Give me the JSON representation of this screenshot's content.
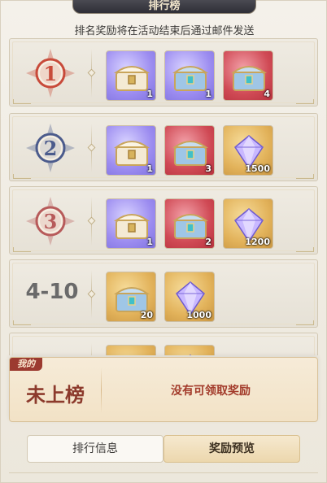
{
  "header": {
    "title": "排行榜",
    "subtitle": "排名奖励将在活动结束后通过邮件发送"
  },
  "rows": [
    {
      "rank_label": "1",
      "badge_color": "#c84a3a",
      "items": [
        {
          "kind": "purple",
          "icon": "chest-icon",
          "qty": "1"
        },
        {
          "kind": "purple",
          "icon": "chest-blue-icon",
          "qty": "1"
        },
        {
          "kind": "red",
          "icon": "chest-blue-icon",
          "qty": "4"
        }
      ]
    },
    {
      "rank_label": "2",
      "badge_color": "#4b5b8c",
      "items": [
        {
          "kind": "purple",
          "icon": "chest-icon",
          "qty": "1"
        },
        {
          "kind": "red",
          "icon": "chest-blue-icon",
          "qty": "3"
        },
        {
          "kind": "gold",
          "icon": "crystal-icon",
          "qty": "1500"
        }
      ]
    },
    {
      "rank_label": "3",
      "badge_color": "#b75a5a",
      "items": [
        {
          "kind": "purple",
          "icon": "chest-icon",
          "qty": "1"
        },
        {
          "kind": "red",
          "icon": "chest-blue-icon",
          "qty": "2"
        },
        {
          "kind": "gold",
          "icon": "crystal-icon",
          "qty": "1200"
        }
      ]
    },
    {
      "rank_label": "4-10",
      "badge_color": "",
      "items": [
        {
          "kind": "gold",
          "icon": "chest-blue-icon",
          "qty": "20"
        },
        {
          "kind": "gold",
          "icon": "crystal-icon",
          "qty": "1000"
        }
      ]
    },
    {
      "rank_label": "",
      "badge_color": "",
      "items": [
        {
          "kind": "gold",
          "icon": "chest-blue-icon",
          "qty": ""
        },
        {
          "kind": "gold",
          "icon": "crystal-icon",
          "qty": ""
        }
      ]
    }
  ],
  "mine": {
    "tag": "我的",
    "status": "未上榜",
    "message": "没有可领取奖励"
  },
  "tabs": {
    "rank_info": "排行信息",
    "reward_preview": "奖励预览"
  }
}
